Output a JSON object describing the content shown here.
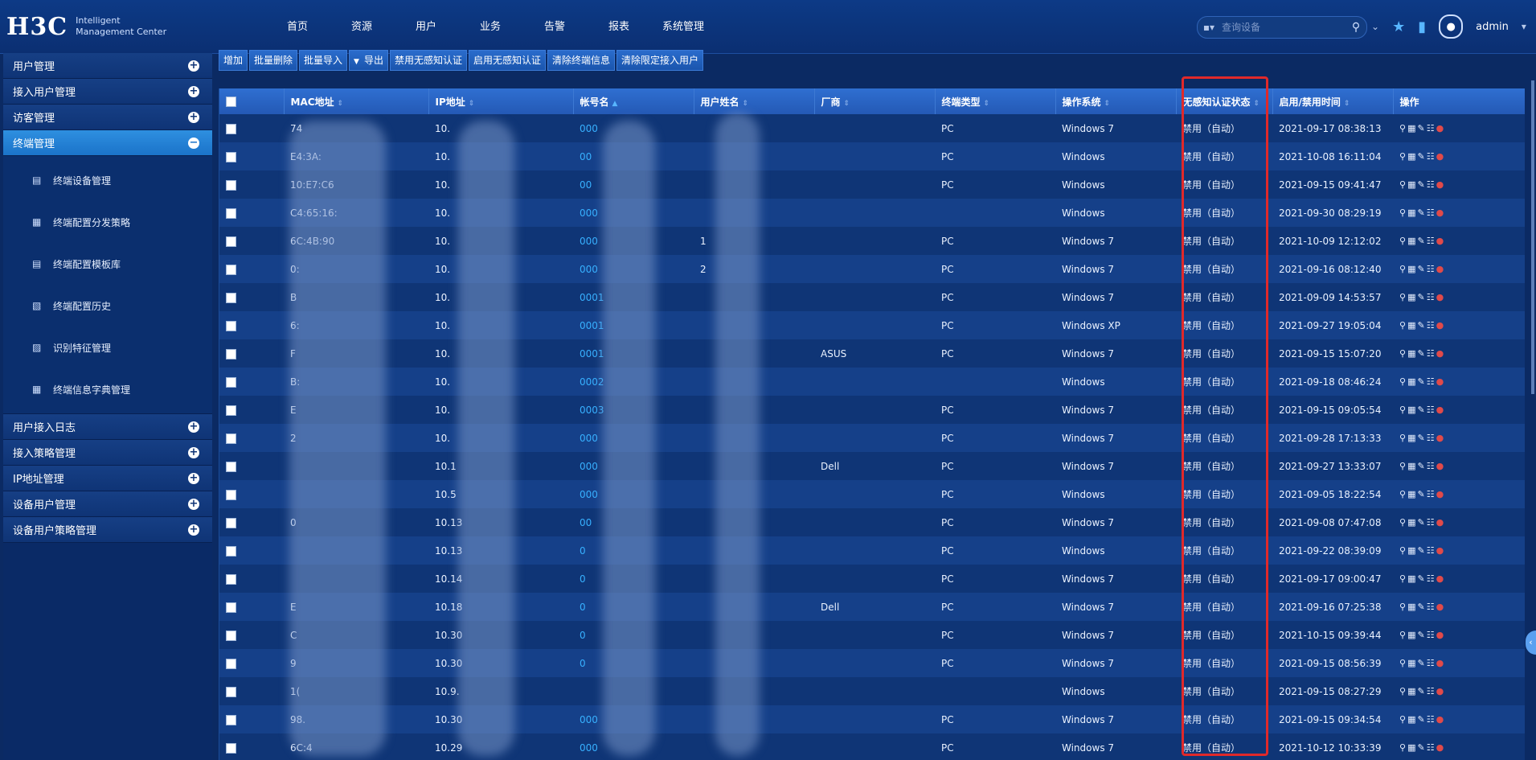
{
  "brand": {
    "logo": "H3C",
    "subtitle_line1": "Intelligent",
    "subtitle_line2": "Management Center"
  },
  "nav": [
    "首页",
    "资源",
    "用户",
    "业务",
    "告警",
    "报表",
    "系统管理"
  ],
  "search": {
    "placeholder": "查询设备"
  },
  "user": {
    "name": "admin"
  },
  "sidebar": {
    "groups_top": [
      {
        "label": "用户管理"
      },
      {
        "label": "接入用户管理"
      },
      {
        "label": "访客管理"
      },
      {
        "label": "终端管理"
      }
    ],
    "sub_items": [
      {
        "label": "终端设备管理"
      },
      {
        "label": "终端配置分发策略"
      },
      {
        "label": "终端配置模板库"
      },
      {
        "label": "终端配置历史"
      },
      {
        "label": "识别特征管理"
      },
      {
        "label": "终端信息字典管理"
      }
    ],
    "groups_bottom": [
      {
        "label": "用户接入日志"
      },
      {
        "label": "接入策略管理"
      },
      {
        "label": "IP地址管理"
      },
      {
        "label": "设备用户管理"
      },
      {
        "label": "设备用户策略管理"
      }
    ]
  },
  "toolbar": [
    "增加",
    "批量删除",
    "批量导入",
    "导出",
    "禁用无感知认证",
    "启用无感知认证",
    "清除终端信息",
    "清除限定接入用户"
  ],
  "table": {
    "headers": [
      "MAC地址",
      "IP地址",
      "帐号名",
      "用户姓名",
      "厂商",
      "终端类型",
      "操作系统",
      "无感知认证状态",
      "启用/禁用时间",
      "操作"
    ],
    "rows": [
      {
        "mac": "74",
        "ip": "10.",
        "acct": "000",
        "name": "",
        "vendor": "",
        "type": "PC",
        "os": "Windows 7",
        "status": "禁用（自动）",
        "time": "2021-09-17 08:38:13"
      },
      {
        "mac": "E4:3A:",
        "ip": "10.",
        "acct": "00",
        "name": "",
        "vendor": "",
        "type": "PC",
        "os": "Windows",
        "status": "禁用（自动）",
        "time": "2021-10-08 16:11:04"
      },
      {
        "mac": "10:E7:C6",
        "ip": "10.",
        "acct": "00",
        "name": "",
        "vendor": "",
        "type": "PC",
        "os": "Windows",
        "status": "禁用（自动）",
        "time": "2021-09-15 09:41:47"
      },
      {
        "mac": "C4:65:16:",
        "ip": "10.",
        "acct": "000",
        "name": "",
        "vendor": "",
        "type": "",
        "os": "Windows",
        "status": "禁用（自动）",
        "time": "2021-09-30 08:29:19"
      },
      {
        "mac": "6C:4B:90",
        "ip": "10.",
        "acct": "000",
        "name": "1",
        "vendor": "",
        "type": "PC",
        "os": "Windows 7",
        "status": "禁用（自动）",
        "time": "2021-10-09 12:12:02"
      },
      {
        "mac": "0:",
        "ip": "10.",
        "acct": "000",
        "name": "2",
        "vendor": "",
        "type": "PC",
        "os": "Windows 7",
        "status": "禁用（自动）",
        "time": "2021-09-16 08:12:40"
      },
      {
        "mac": "B",
        "ip": "10.",
        "acct": "0001",
        "name": "",
        "vendor": "",
        "type": "PC",
        "os": "Windows 7",
        "status": "禁用（自动）",
        "time": "2021-09-09 14:53:57"
      },
      {
        "mac": "6:",
        "ip": "10.",
        "acct": "0001",
        "name": "",
        "vendor": "",
        "type": "PC",
        "os": "Windows XP",
        "status": "禁用（自动）",
        "time": "2021-09-27 19:05:04"
      },
      {
        "mac": "F",
        "ip": "10.",
        "acct": "0001",
        "name": "",
        "vendor": "ASUS",
        "type": "PC",
        "os": "Windows 7",
        "status": "禁用（自动）",
        "time": "2021-09-15 15:07:20"
      },
      {
        "mac": "B:",
        "ip": "10.",
        "acct": "0002",
        "name": "",
        "vendor": "",
        "type": "",
        "os": "Windows",
        "status": "禁用（自动）",
        "time": "2021-09-18 08:46:24"
      },
      {
        "mac": "E",
        "ip": "10.",
        "acct": "0003",
        "name": "",
        "vendor": "",
        "type": "PC",
        "os": "Windows 7",
        "status": "禁用（自动）",
        "time": "2021-09-15 09:05:54"
      },
      {
        "mac": "2",
        "ip": "10.",
        "acct": "000",
        "name": "",
        "vendor": "",
        "type": "PC",
        "os": "Windows 7",
        "status": "禁用（自动）",
        "time": "2021-09-28 17:13:33"
      },
      {
        "mac": "",
        "ip": "10.1",
        "acct": "000",
        "name": "",
        "vendor": "Dell",
        "type": "PC",
        "os": "Windows 7",
        "status": "禁用（自动）",
        "time": "2021-09-27 13:33:07"
      },
      {
        "mac": "",
        "ip": "10.5",
        "acct": "000",
        "name": "",
        "vendor": "",
        "type": "PC",
        "os": "Windows",
        "status": "禁用（自动）",
        "time": "2021-09-05 18:22:54"
      },
      {
        "mac": "0",
        "ip": "10.13",
        "acct": "00",
        "name": "",
        "vendor": "",
        "type": "PC",
        "os": "Windows 7",
        "status": "禁用（自动）",
        "time": "2021-09-08 07:47:08"
      },
      {
        "mac": "",
        "ip": "10.13",
        "acct": "0",
        "name": "",
        "vendor": "",
        "type": "PC",
        "os": "Windows",
        "status": "禁用（自动）",
        "time": "2021-09-22 08:39:09"
      },
      {
        "mac": "",
        "ip": "10.14",
        "acct": "0",
        "name": "",
        "vendor": "",
        "type": "PC",
        "os": "Windows 7",
        "status": "禁用（自动）",
        "time": "2021-09-17 09:00:47"
      },
      {
        "mac": "E",
        "ip": "10.18",
        "acct": "0",
        "name": "",
        "vendor": "Dell",
        "type": "PC",
        "os": "Windows 7",
        "status": "禁用（自动）",
        "time": "2021-09-16 07:25:38"
      },
      {
        "mac": "C",
        "ip": "10.30",
        "acct": "0",
        "name": "",
        "vendor": "",
        "type": "PC",
        "os": "Windows 7",
        "status": "禁用（自动）",
        "time": "2021-10-15 09:39:44"
      },
      {
        "mac": "9",
        "ip": "10.30",
        "acct": "0",
        "name": "",
        "vendor": "",
        "type": "PC",
        "os": "Windows 7",
        "status": "禁用（自动）",
        "time": "2021-09-15 08:56:39"
      },
      {
        "mac": "1(",
        "ip": "10.9.",
        "acct": "",
        "name": "",
        "vendor": "",
        "type": "",
        "os": "Windows",
        "status": "禁用（自动）",
        "time": "2021-09-15 08:27:29"
      },
      {
        "mac": "98.",
        "ip": "10.30",
        "acct": "000",
        "name": "",
        "vendor": "",
        "type": "PC",
        "os": "Windows 7",
        "status": "禁用（自动）",
        "time": "2021-09-15 09:34:54"
      },
      {
        "mac": "6C:4",
        "ip": "10.29",
        "acct": "000",
        "name": "",
        "vendor": "",
        "type": "PC",
        "os": "Windows 7",
        "status": "禁用（自动）",
        "time": "2021-10-12 10:33:39"
      }
    ]
  },
  "colors": {
    "accent": "#37b0ff",
    "highlight": "#e0292a",
    "header": "#2f6fd1"
  }
}
